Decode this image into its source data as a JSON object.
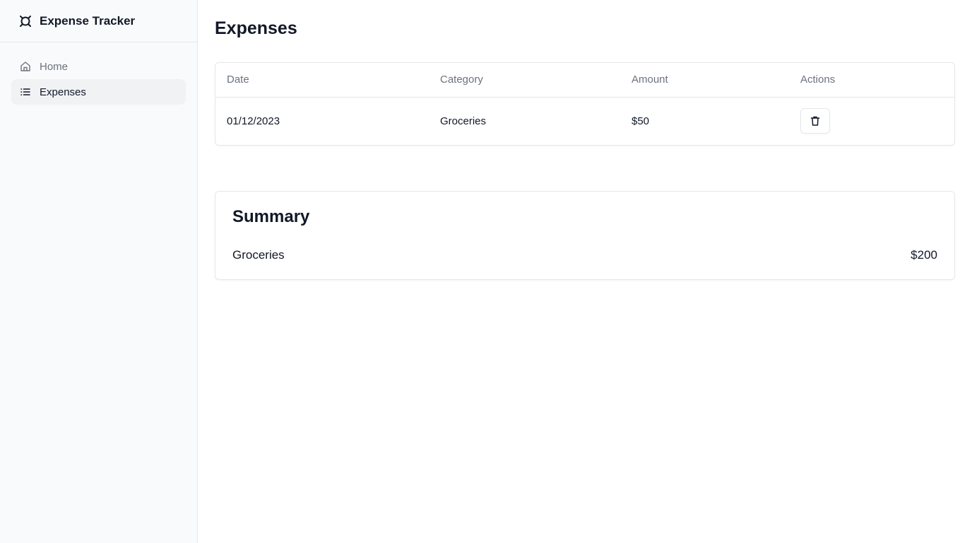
{
  "app": {
    "name": "Expense Tracker",
    "logo_icon": "expense-tracker-logo-icon"
  },
  "sidebar": {
    "items": [
      {
        "label": "Home",
        "icon": "home-icon",
        "active": false
      },
      {
        "label": "Expenses",
        "icon": "list-icon",
        "active": true
      }
    ]
  },
  "main": {
    "title": "Expenses",
    "table": {
      "headers": [
        "Date",
        "Category",
        "Amount",
        "Actions"
      ],
      "rows": [
        {
          "date": "01/12/2023",
          "category": "Groceries",
          "amount": "$50",
          "action_icon": "trash-icon"
        }
      ]
    },
    "summary": {
      "title": "Summary",
      "items": [
        {
          "category": "Groceries",
          "total": "$200"
        }
      ]
    }
  },
  "colors": {
    "sidebar_bg": "#f9fafb",
    "active_item_bg": "#f1f2f4",
    "border": "#e5e7eb",
    "muted_text": "#6b7280",
    "text": "#111827"
  }
}
